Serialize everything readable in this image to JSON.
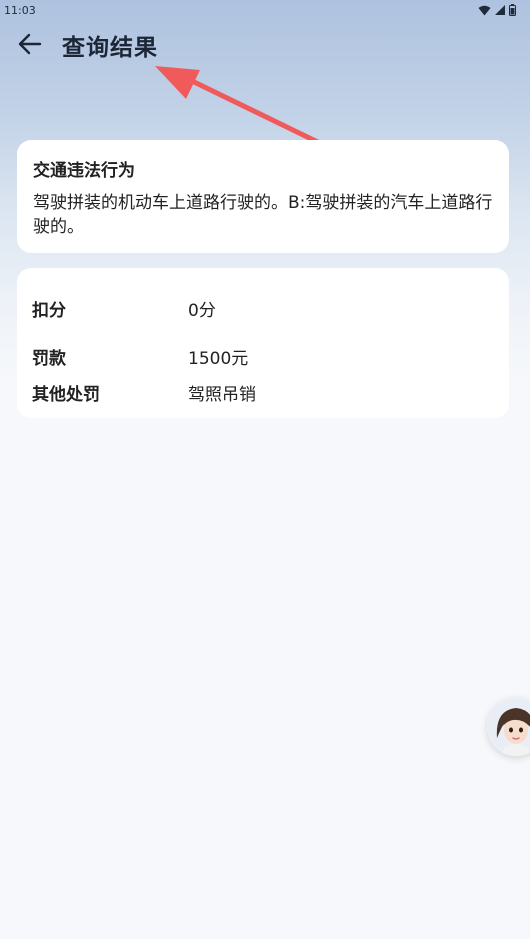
{
  "status_bar": {
    "time": "11:03"
  },
  "header": {
    "title": "查询结果",
    "back_icon": "back-arrow-icon"
  },
  "violation": {
    "title": "交通违法行为",
    "description": "驾驶拼装的机动车上道路行驶的。B:驾驶拼装的汽车上道路行驶的。"
  },
  "penalty": {
    "rows": [
      {
        "label": "扣分",
        "value": "0分"
      },
      {
        "label": "罚款",
        "value": "1500元"
      },
      {
        "label": "其他处罚",
        "value": "驾照吊销"
      }
    ]
  },
  "assistant": {
    "icon": "assistant-avatar-icon"
  },
  "colors": {
    "annotation_arrow": "#f05a5a",
    "title_text": "#1b2636",
    "card_bg": "#ffffff"
  }
}
